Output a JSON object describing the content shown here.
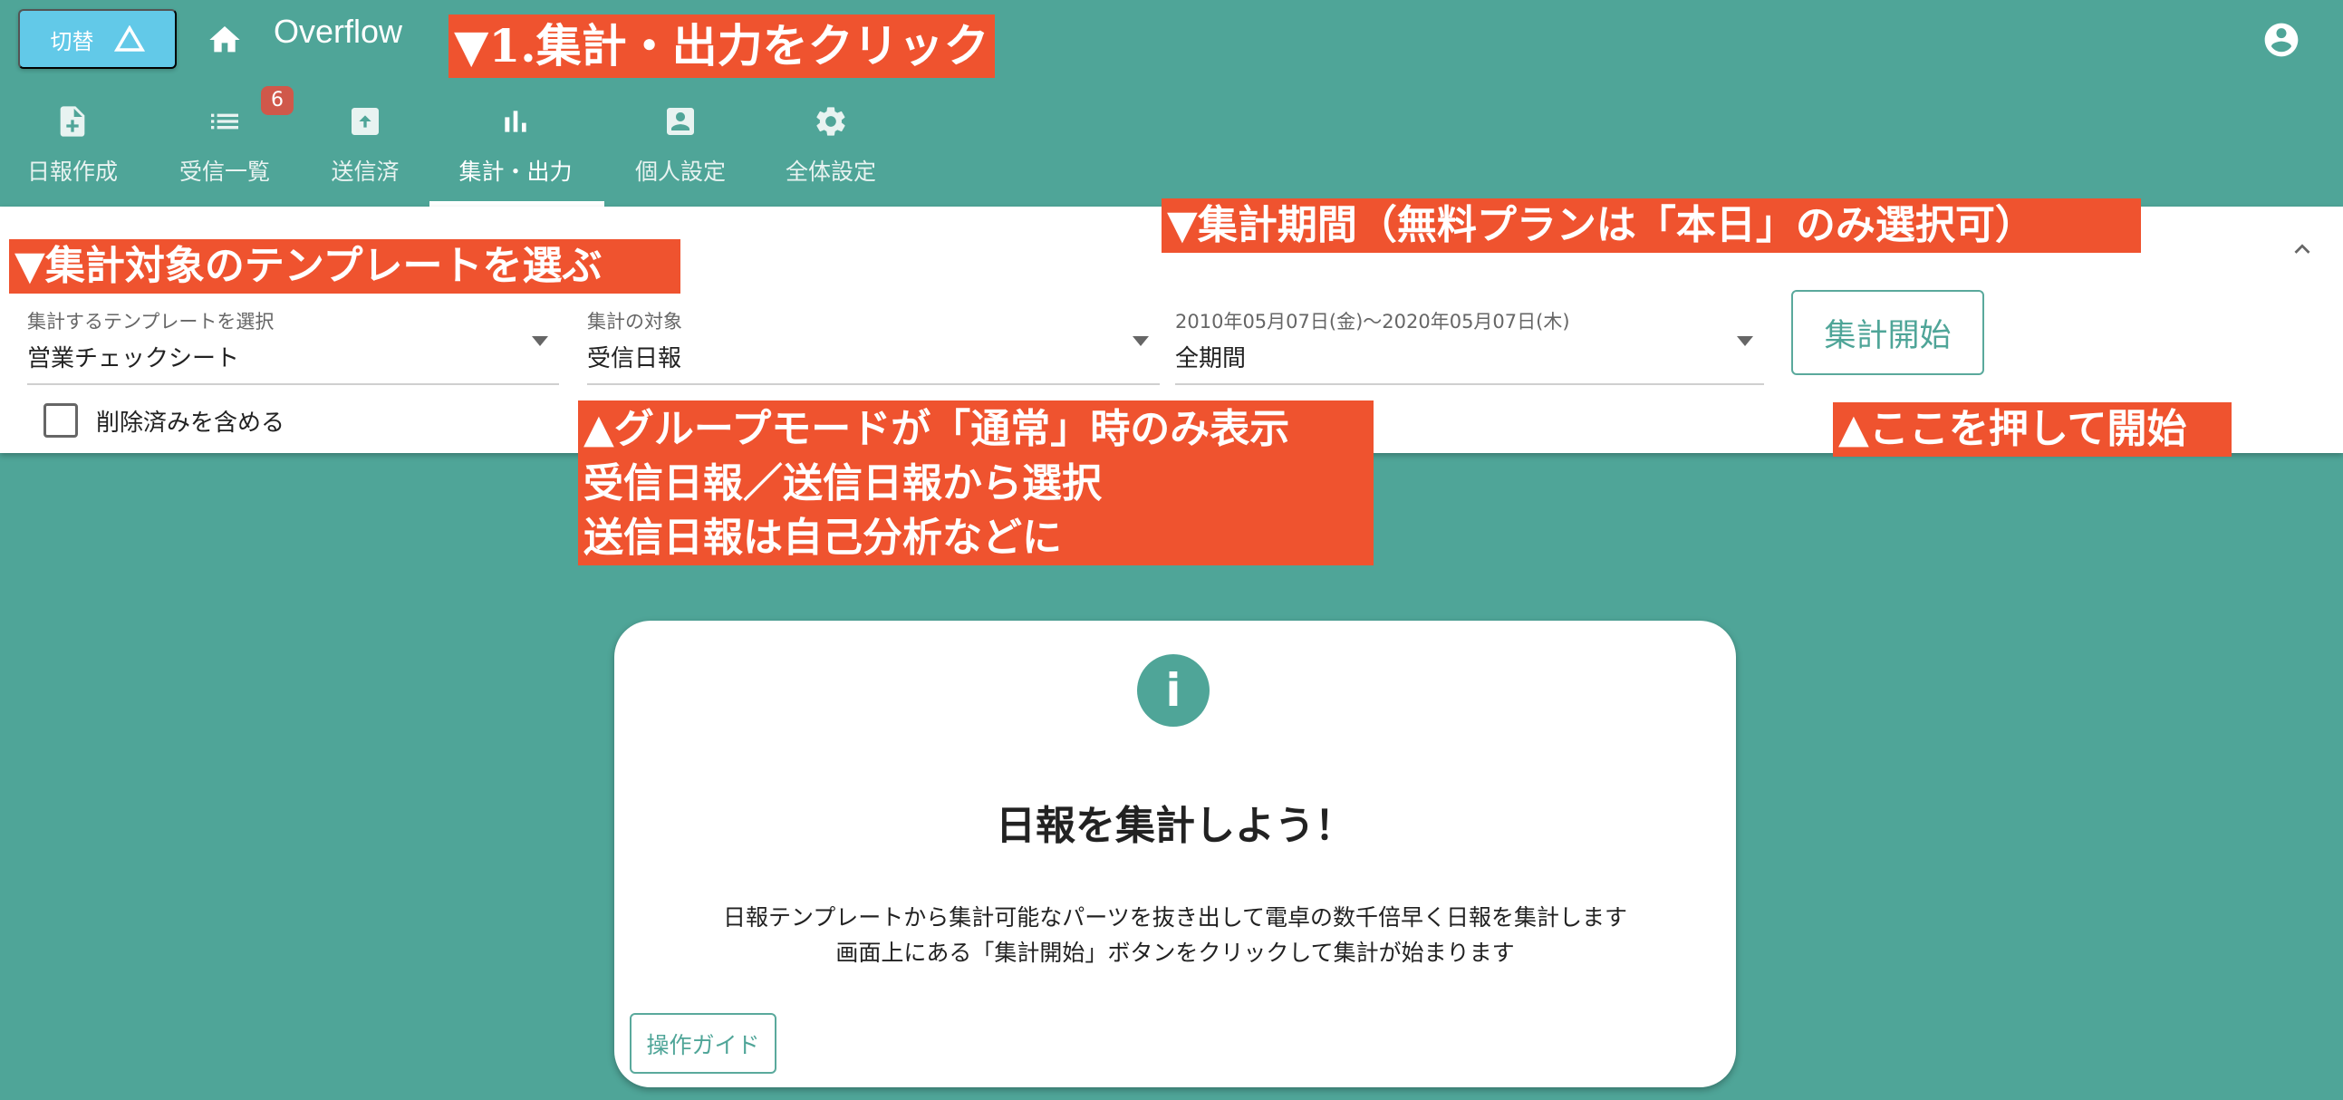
{
  "header": {
    "switch_label": "切替",
    "title": "Overflow"
  },
  "nav": {
    "tabs": [
      {
        "label": "日報作成",
        "icon": "note-add-icon"
      },
      {
        "label": "受信一覧",
        "icon": "list-icon",
        "badge": "6"
      },
      {
        "label": "送信済",
        "icon": "outbox-icon"
      },
      {
        "label": "集計・出力",
        "icon": "bar-chart-icon",
        "active": true
      },
      {
        "label": "個人設定",
        "icon": "account-box-icon"
      },
      {
        "label": "全体設定",
        "icon": "gear-icon"
      }
    ]
  },
  "form": {
    "template": {
      "label": "集計するテンプレートを選択",
      "value": "営業チェックシート"
    },
    "target": {
      "label": "集計の対象",
      "value": "受信日報"
    },
    "period": {
      "label": "2010年05月07日(金)〜2020年05月07日(木)",
      "value": "全期間"
    },
    "start_button": "集計開始",
    "include_deleted": "削除済みを含める"
  },
  "annotations": {
    "a1": "▼1.集計・出力をクリック",
    "a2": "▼集計対象のテンプレートを選ぶ",
    "a3": "▼集計期間（無料プランは「本日」のみ選択可）",
    "a4": [
      "▲グループモードが「通常」時のみ表示",
      "受信日報／送信日報から選択",
      "送信日報は自己分析などに"
    ],
    "a5": "▲ここを押して開始"
  },
  "card": {
    "title": "日報を集計しよう！",
    "lines": [
      "日報テンプレートから集計可能なパーツを抜き出して電卓の数千倍早く日報を集計します",
      "画面上にある「集計開始」ボタンをクリックして集計が始まります"
    ],
    "guide_button": "操作ガイド"
  },
  "colors": {
    "primary": "#4fa598",
    "annotation": "#ef532f",
    "switch": "#62c9e8",
    "badge": "#d0584a"
  }
}
